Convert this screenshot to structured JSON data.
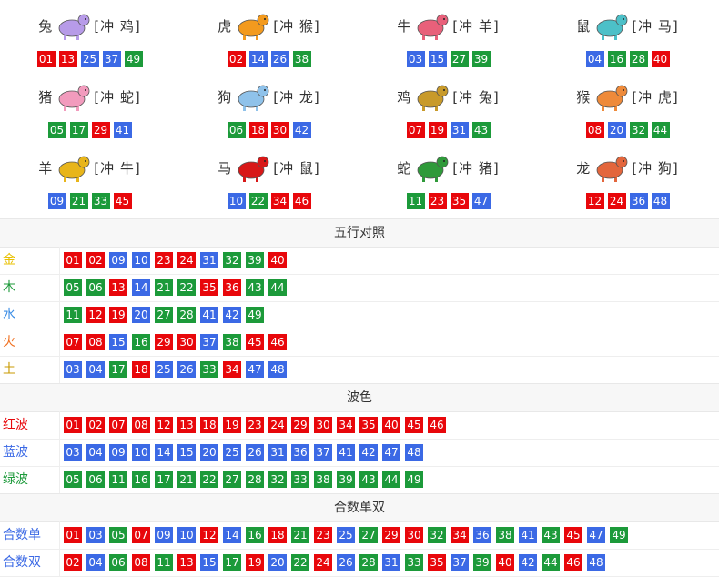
{
  "zodiacs": [
    {
      "name": "兔",
      "clash": "[冲 鸡]",
      "icon": "rabbit-icon",
      "color": "#b79be8",
      "balls": [
        [
          "01",
          "red"
        ],
        [
          "13",
          "red"
        ],
        [
          "25",
          "blue"
        ],
        [
          "37",
          "blue"
        ],
        [
          "49",
          "green"
        ]
      ]
    },
    {
      "name": "虎",
      "clash": "[冲 猴]",
      "icon": "tiger-icon",
      "color": "#f39a1e",
      "balls": [
        [
          "02",
          "red"
        ],
        [
          "14",
          "blue"
        ],
        [
          "26",
          "blue"
        ],
        [
          "38",
          "green"
        ]
      ]
    },
    {
      "name": "牛",
      "clash": "[冲 羊]",
      "icon": "ox-icon",
      "color": "#e8607a",
      "balls": [
        [
          "03",
          "blue"
        ],
        [
          "15",
          "blue"
        ],
        [
          "27",
          "green"
        ],
        [
          "39",
          "green"
        ]
      ]
    },
    {
      "name": "鼠",
      "clash": "[冲 马]",
      "icon": "rat-icon",
      "color": "#4cc0c8",
      "balls": [
        [
          "04",
          "blue"
        ],
        [
          "16",
          "green"
        ],
        [
          "28",
          "green"
        ],
        [
          "40",
          "red"
        ]
      ]
    },
    {
      "name": "猪",
      "clash": "[冲 蛇]",
      "icon": "pig-icon",
      "color": "#f29bbd",
      "balls": [
        [
          "05",
          "green"
        ],
        [
          "17",
          "green"
        ],
        [
          "29",
          "red"
        ],
        [
          "41",
          "blue"
        ]
      ]
    },
    {
      "name": "狗",
      "clash": "[冲 龙]",
      "icon": "dog-icon",
      "color": "#8fc2ea",
      "balls": [
        [
          "06",
          "green"
        ],
        [
          "18",
          "red"
        ],
        [
          "30",
          "red"
        ],
        [
          "42",
          "blue"
        ]
      ]
    },
    {
      "name": "鸡",
      "clash": "[冲 兔]",
      "icon": "rooster-icon",
      "color": "#c89a2a",
      "balls": [
        [
          "07",
          "red"
        ],
        [
          "19",
          "red"
        ],
        [
          "31",
          "blue"
        ],
        [
          "43",
          "green"
        ]
      ]
    },
    {
      "name": "猴",
      "clash": "[冲 虎]",
      "icon": "monkey-icon",
      "color": "#ee8a3a",
      "balls": [
        [
          "08",
          "red"
        ],
        [
          "20",
          "blue"
        ],
        [
          "32",
          "green"
        ],
        [
          "44",
          "green"
        ]
      ]
    },
    {
      "name": "羊",
      "clash": "[冲 牛]",
      "icon": "goat-icon",
      "color": "#e8b51a",
      "balls": [
        [
          "09",
          "blue"
        ],
        [
          "21",
          "green"
        ],
        [
          "33",
          "green"
        ],
        [
          "45",
          "red"
        ]
      ]
    },
    {
      "name": "马",
      "clash": "[冲 鼠]",
      "icon": "horse-icon",
      "color": "#d81818",
      "balls": [
        [
          "10",
          "blue"
        ],
        [
          "22",
          "green"
        ],
        [
          "34",
          "red"
        ],
        [
          "46",
          "red"
        ]
      ]
    },
    {
      "name": "蛇",
      "clash": "[冲 猪]",
      "icon": "snake-icon",
      "color": "#2f9a3a",
      "balls": [
        [
          "11",
          "green"
        ],
        [
          "23",
          "red"
        ],
        [
          "35",
          "red"
        ],
        [
          "47",
          "blue"
        ]
      ]
    },
    {
      "name": "龙",
      "clash": "[冲 狗]",
      "icon": "dragon-icon",
      "color": "#e3663c",
      "balls": [
        [
          "12",
          "red"
        ],
        [
          "24",
          "red"
        ],
        [
          "36",
          "blue"
        ],
        [
          "48",
          "blue"
        ]
      ]
    }
  ],
  "wuxing": {
    "title": "五行对照",
    "rows": [
      {
        "label": "金",
        "label_color": "#e8c000",
        "balls": [
          [
            "01",
            "red"
          ],
          [
            "02",
            "red"
          ],
          [
            "09",
            "blue"
          ],
          [
            "10",
            "blue"
          ],
          [
            "23",
            "red"
          ],
          [
            "24",
            "red"
          ],
          [
            "31",
            "blue"
          ],
          [
            "32",
            "green"
          ],
          [
            "39",
            "green"
          ],
          [
            "40",
            "red"
          ]
        ]
      },
      {
        "label": "木",
        "label_color": "#1c9a3a",
        "balls": [
          [
            "05",
            "green"
          ],
          [
            "06",
            "green"
          ],
          [
            "13",
            "red"
          ],
          [
            "14",
            "blue"
          ],
          [
            "21",
            "green"
          ],
          [
            "22",
            "green"
          ],
          [
            "35",
            "red"
          ],
          [
            "36",
            "red"
          ],
          [
            "43",
            "green"
          ],
          [
            "44",
            "green"
          ]
        ]
      },
      {
        "label": "水",
        "label_color": "#3b8de5",
        "balls": [
          [
            "11",
            "green"
          ],
          [
            "12",
            "red"
          ],
          [
            "19",
            "red"
          ],
          [
            "20",
            "blue"
          ],
          [
            "27",
            "green"
          ],
          [
            "28",
            "green"
          ],
          [
            "41",
            "blue"
          ],
          [
            "42",
            "blue"
          ],
          [
            "49",
            "green"
          ]
        ]
      },
      {
        "label": "火",
        "label_color": "#f07020",
        "balls": [
          [
            "07",
            "red"
          ],
          [
            "08",
            "red"
          ],
          [
            "15",
            "blue"
          ],
          [
            "16",
            "green"
          ],
          [
            "29",
            "red"
          ],
          [
            "30",
            "red"
          ],
          [
            "37",
            "blue"
          ],
          [
            "38",
            "green"
          ],
          [
            "45",
            "red"
          ],
          [
            "46",
            "red"
          ]
        ]
      },
      {
        "label": "土",
        "label_color": "#c89a00",
        "balls": [
          [
            "03",
            "blue"
          ],
          [
            "04",
            "blue"
          ],
          [
            "17",
            "green"
          ],
          [
            "18",
            "red"
          ],
          [
            "25",
            "blue"
          ],
          [
            "26",
            "blue"
          ],
          [
            "33",
            "green"
          ],
          [
            "34",
            "red"
          ],
          [
            "47",
            "blue"
          ],
          [
            "48",
            "blue"
          ]
        ]
      }
    ]
  },
  "bose": {
    "title": "波色",
    "rows": [
      {
        "label": "红波",
        "label_color": "#e8070b",
        "balls": [
          [
            "01",
            "red"
          ],
          [
            "02",
            "red"
          ],
          [
            "07",
            "red"
          ],
          [
            "08",
            "red"
          ],
          [
            "12",
            "red"
          ],
          [
            "13",
            "red"
          ],
          [
            "18",
            "red"
          ],
          [
            "19",
            "red"
          ],
          [
            "23",
            "red"
          ],
          [
            "24",
            "red"
          ],
          [
            "29",
            "red"
          ],
          [
            "30",
            "red"
          ],
          [
            "34",
            "red"
          ],
          [
            "35",
            "red"
          ],
          [
            "40",
            "red"
          ],
          [
            "45",
            "red"
          ],
          [
            "46",
            "red"
          ]
        ]
      },
      {
        "label": "蓝波",
        "label_color": "#3b69e5",
        "balls": [
          [
            "03",
            "blue"
          ],
          [
            "04",
            "blue"
          ],
          [
            "09",
            "blue"
          ],
          [
            "10",
            "blue"
          ],
          [
            "14",
            "blue"
          ],
          [
            "15",
            "blue"
          ],
          [
            "20",
            "blue"
          ],
          [
            "25",
            "blue"
          ],
          [
            "26",
            "blue"
          ],
          [
            "31",
            "blue"
          ],
          [
            "36",
            "blue"
          ],
          [
            "37",
            "blue"
          ],
          [
            "41",
            "blue"
          ],
          [
            "42",
            "blue"
          ],
          [
            "47",
            "blue"
          ],
          [
            "48",
            "blue"
          ]
        ]
      },
      {
        "label": "绿波",
        "label_color": "#1c9a3a",
        "balls": [
          [
            "05",
            "green"
          ],
          [
            "06",
            "green"
          ],
          [
            "11",
            "green"
          ],
          [
            "16",
            "green"
          ],
          [
            "17",
            "green"
          ],
          [
            "21",
            "green"
          ],
          [
            "22",
            "green"
          ],
          [
            "27",
            "green"
          ],
          [
            "28",
            "green"
          ],
          [
            "32",
            "green"
          ],
          [
            "33",
            "green"
          ],
          [
            "38",
            "green"
          ],
          [
            "39",
            "green"
          ],
          [
            "43",
            "green"
          ],
          [
            "44",
            "green"
          ],
          [
            "49",
            "green"
          ]
        ]
      }
    ]
  },
  "heshu": {
    "title": "合数单双",
    "rows": [
      {
        "label": "合数单",
        "label_color": "#3b69e5",
        "balls": [
          [
            "01",
            "red"
          ],
          [
            "03",
            "blue"
          ],
          [
            "05",
            "green"
          ],
          [
            "07",
            "red"
          ],
          [
            "09",
            "blue"
          ],
          [
            "10",
            "blue"
          ],
          [
            "12",
            "red"
          ],
          [
            "14",
            "blue"
          ],
          [
            "16",
            "green"
          ],
          [
            "18",
            "red"
          ],
          [
            "21",
            "green"
          ],
          [
            "23",
            "red"
          ],
          [
            "25",
            "blue"
          ],
          [
            "27",
            "green"
          ],
          [
            "29",
            "red"
          ],
          [
            "30",
            "red"
          ],
          [
            "32",
            "green"
          ],
          [
            "34",
            "red"
          ],
          [
            "36",
            "blue"
          ],
          [
            "38",
            "green"
          ],
          [
            "41",
            "blue"
          ],
          [
            "43",
            "green"
          ],
          [
            "45",
            "red"
          ],
          [
            "47",
            "blue"
          ],
          [
            "49",
            "green"
          ]
        ]
      },
      {
        "label": "合数双",
        "label_color": "#3b69e5",
        "balls": [
          [
            "02",
            "red"
          ],
          [
            "04",
            "blue"
          ],
          [
            "06",
            "green"
          ],
          [
            "08",
            "red"
          ],
          [
            "11",
            "green"
          ],
          [
            "13",
            "red"
          ],
          [
            "15",
            "blue"
          ],
          [
            "17",
            "green"
          ],
          [
            "19",
            "red"
          ],
          [
            "20",
            "blue"
          ],
          [
            "22",
            "green"
          ],
          [
            "24",
            "red"
          ],
          [
            "26",
            "blue"
          ],
          [
            "28",
            "green"
          ],
          [
            "31",
            "blue"
          ],
          [
            "33",
            "green"
          ],
          [
            "35",
            "red"
          ],
          [
            "37",
            "blue"
          ],
          [
            "39",
            "green"
          ],
          [
            "40",
            "red"
          ],
          [
            "42",
            "blue"
          ],
          [
            "44",
            "green"
          ],
          [
            "46",
            "red"
          ],
          [
            "48",
            "blue"
          ]
        ]
      }
    ]
  }
}
